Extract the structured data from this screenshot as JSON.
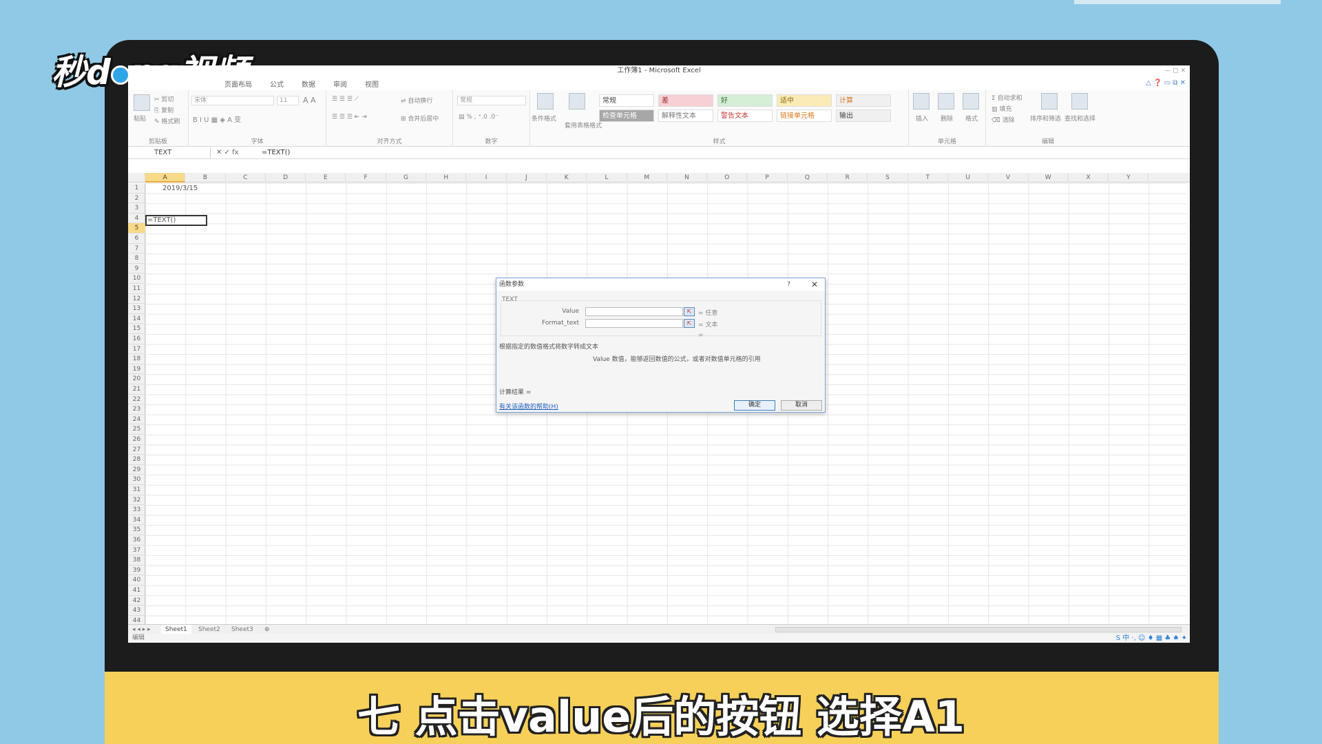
{
  "overlay": {
    "logo_text_1": "秒d",
    "logo_text_2": "ng视频",
    "caption": "七 点击value后的按钮 选择A1"
  },
  "window": {
    "title": "工作簿1 - Microsoft Excel"
  },
  "menu": {
    "items": [
      "页面布局",
      "公式",
      "数据",
      "审阅",
      "视图"
    ]
  },
  "ribbon": {
    "clipboard": {
      "label": "剪贴板",
      "paste": "粘贴",
      "cut": "剪切",
      "copy": "复制",
      "format_painter": "格式刷"
    },
    "font": {
      "label": "字体",
      "name": "宋体",
      "size": "11"
    },
    "alignment": {
      "label": "对齐方式",
      "wrap": "自动换行",
      "merge": "合并后居中"
    },
    "number": {
      "label": "数字",
      "format": "常规"
    },
    "styles": {
      "label": "样式",
      "conditional": "条件格式",
      "table": "套用表格格式",
      "cells": [
        {
          "text": "常规",
          "bg": "#ffffff",
          "color": "#444444"
        },
        {
          "text": "差",
          "bg": "#f6d0d3",
          "color": "#9c2a2f"
        },
        {
          "text": "好",
          "bg": "#d5eed6",
          "color": "#2f6b33"
        },
        {
          "text": "适中",
          "bg": "#fbebb6",
          "color": "#8a6a12"
        },
        {
          "text": "计算",
          "bg": "#f0f0f0",
          "color": "#d87a20"
        },
        {
          "text": "检查单元格",
          "bg": "#a7a7a7",
          "color": "#ffffff"
        },
        {
          "text": "解释性文本",
          "bg": "#ffffff",
          "color": "#7a7a7a"
        },
        {
          "text": "警告文本",
          "bg": "#ffffff",
          "color": "#c63a3a"
        },
        {
          "text": "链接单元格",
          "bg": "#ffffff",
          "color": "#d87a20"
        },
        {
          "text": "输出",
          "bg": "#f0f0f0",
          "color": "#444444"
        }
      ]
    },
    "cells": {
      "label": "单元格",
      "insert": "插入",
      "delete": "删除",
      "format": "格式"
    },
    "editing": {
      "label": "编辑",
      "autosum": "自动求和",
      "fill": "填充",
      "clear": "清除",
      "sort": "排序和筛选",
      "find": "查找和选择"
    }
  },
  "formula_bar": {
    "name_box": "TEXT",
    "icons": "✕ ✓ fx",
    "formula": "=TEXT()"
  },
  "columns": [
    "A",
    "B",
    "C",
    "D",
    "E",
    "F",
    "G",
    "H",
    "I",
    "J",
    "K",
    "L",
    "M",
    "N",
    "O",
    "P",
    "Q",
    "R",
    "S",
    "T",
    "U",
    "V",
    "W",
    "X",
    "Y"
  ],
  "selected_column": "A",
  "row_count": 44,
  "selected_row": 5,
  "cells": {
    "a1": "2019/3/15",
    "a5": "=TEXT()"
  },
  "dialog": {
    "title": "函数参数",
    "help": "?",
    "close": "✕",
    "function_name": "TEXT",
    "args": [
      {
        "label": "Value",
        "result": "= 任意"
      },
      {
        "label": "Format_text",
        "result": "= 文本"
      }
    ],
    "equals": "=",
    "description": "根据指定的数值格式将数字转成文本",
    "arg_description": "Value  数值，能够返回数值的公式，或者对数值单元格的引用",
    "result_label": "计算结果 =",
    "help_link": "有关该函数的帮助(H)",
    "ok": "确定",
    "cancel": "取消"
  },
  "sheets": [
    "Sheet1",
    "Sheet2",
    "Sheet3"
  ],
  "status": {
    "mode": "编辑",
    "tray": "S 中 ·, ☺ ♦ ▦ ♣ ♠ ✦"
  }
}
